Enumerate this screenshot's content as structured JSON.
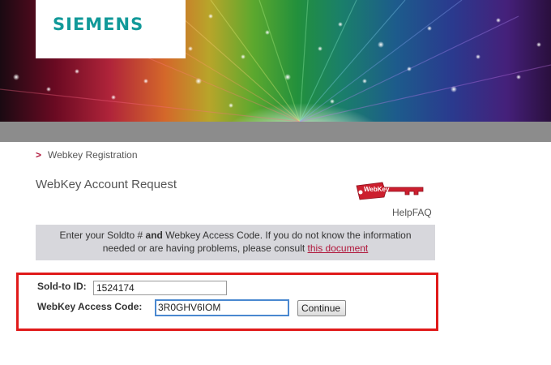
{
  "brand": {
    "name": "SIEMENS",
    "color": "#119999"
  },
  "breadcrumb": {
    "label": "Webkey Registration"
  },
  "page": {
    "title": "WebKey Account Request"
  },
  "webkey_tag": {
    "label": "WebKey"
  },
  "links": {
    "help": "Help",
    "faq": "FAQ"
  },
  "info": {
    "part1": "Enter your Soldto # ",
    "and": "and",
    "part2": " Webkey Access Code. If you do not know the information",
    "line2": "needed or are having problems, please consult ",
    "link": "this document"
  },
  "form": {
    "soldto_label": "Sold-to ID:",
    "soldto_value": "1524174",
    "access_label": "WebKey Access Code:",
    "access_value": "3R0GHV6IOM",
    "continue_label": "Continue"
  },
  "colors": {
    "accent_red": "#b0153a",
    "highlight_frame": "#e01a1a",
    "info_bg": "#d7d7dc"
  }
}
